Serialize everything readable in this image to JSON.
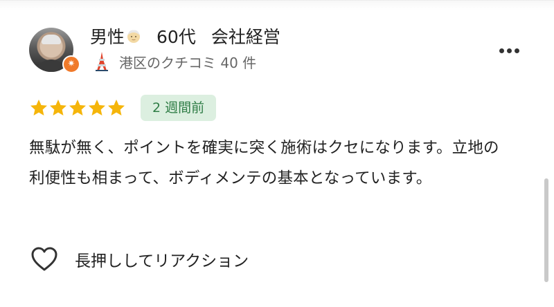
{
  "review": {
    "user": {
      "gender": "男性",
      "age": "60代",
      "occupation": "会社経営",
      "area_label": "港区のクチコミ 40 件",
      "face_icon": "elderly-face-emoji",
      "badge_icon": "star-badge-icon",
      "area_icon": "tokyo-tower-icon"
    },
    "rating": {
      "stars": 5,
      "max_stars": 5,
      "star_color": "#f5b50a"
    },
    "time_label": "2 週間前",
    "text": "無駄が無く、ポイントを確実に突く施術はクセになります。立地の利便性も相まって、ボディメンテの基本となっています。",
    "reaction_label": "長押ししてリアクション"
  },
  "colors": {
    "time_badge_bg": "#dcefe0",
    "time_badge_text": "#2f7d46",
    "badge_orange": "#f07a2a"
  }
}
